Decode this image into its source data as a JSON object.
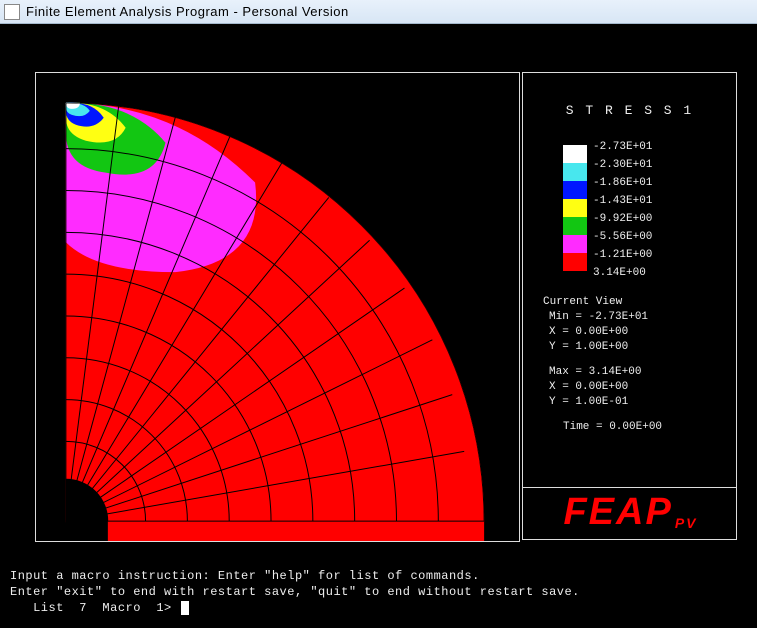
{
  "window": {
    "title": "Finite Element Analysis Program - Personal Version"
  },
  "legend": {
    "title": "S T R E S S  1",
    "entries": [
      {
        "color": "#ffffff",
        "label": "-2.73E+01"
      },
      {
        "color": "#48e7ee",
        "label": "-2.30E+01"
      },
      {
        "color": "#0016ff",
        "label": "-1.86E+01"
      },
      {
        "color": "#ffff12",
        "label": "-1.43E+01"
      },
      {
        "color": "#12c612",
        "label": "-9.92E+00"
      },
      {
        "color": "#ff2bff",
        "label": "-5.56E+00"
      },
      {
        "color": "#ff0000",
        "label": "-1.21E+00"
      }
    ],
    "final_label": " 3.14E+00"
  },
  "view": {
    "heading": "Current View",
    "min_label": "Min = -2.73E+01",
    "min_x": "X = 0.00E+00",
    "min_y": "Y = 1.00E+00",
    "max_label": "Max =  3.14E+00",
    "max_x": "X = 0.00E+00",
    "max_y": "Y = 1.00E-01",
    "time": "Time = 0.00E+00"
  },
  "logo": {
    "text": "FEAP",
    "sub": "PV"
  },
  "console": {
    "line1": "Input a macro instruction: Enter \"help\" for list of commands.",
    "line2": "Enter \"exit\" to end with restart save, \"quit\" to end without restart save.",
    "prompt": "   List  7  Macro  1> "
  },
  "chart_data": {
    "type": "heatmap",
    "title": "STRESS 1",
    "description": "Quarter-annulus FE mesh (inner radius 0.1, outer radius 1.0, 0–90°) colored by STRESS 1 contour bands",
    "color_scale": [
      {
        "threshold": -27.3,
        "color": "#ffffff"
      },
      {
        "threshold": -23.0,
        "color": "#48e7ee"
      },
      {
        "threshold": -18.6,
        "color": "#0016ff"
      },
      {
        "threshold": -14.3,
        "color": "#ffff12"
      },
      {
        "threshold": -9.92,
        "color": "#12c612"
      },
      {
        "threshold": -5.56,
        "color": "#ff2bff"
      },
      {
        "threshold": -1.21,
        "color": "#ff0000"
      },
      {
        "threshold": 3.14,
        "color": "#ff0000"
      }
    ],
    "value_range": {
      "min": -27.3,
      "max": 3.14
    },
    "min_location": {
      "x": 0.0,
      "y": 1.0
    },
    "max_location": {
      "x": 0.0,
      "y": 0.1
    },
    "time": 0.0,
    "geometry": {
      "inner_radius": 0.1,
      "outer_radius": 1.0,
      "theta_start_deg": 0,
      "theta_end_deg": 90
    }
  }
}
